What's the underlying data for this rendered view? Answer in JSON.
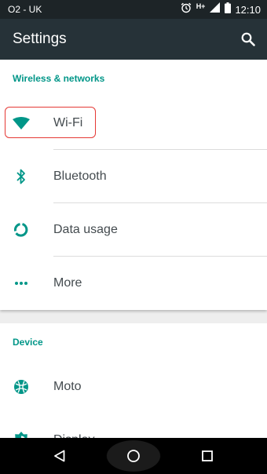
{
  "status_bar": {
    "carrier": "O2 - UK",
    "network_type": "H+",
    "time": "12:10",
    "icons": [
      "alarm-icon",
      "signal-icon",
      "battery-icon"
    ]
  },
  "app_bar": {
    "title": "Settings",
    "action_icon": "search-icon"
  },
  "sections": [
    {
      "header": "Wireless & networks",
      "items": [
        {
          "label": "Wi-Fi",
          "icon": "wifi-icon",
          "highlighted": true
        },
        {
          "label": "Bluetooth",
          "icon": "bluetooth-icon"
        },
        {
          "label": "Data usage",
          "icon": "data-usage-icon"
        },
        {
          "label": "More",
          "icon": "more-icon"
        }
      ]
    },
    {
      "header": "Device",
      "items": [
        {
          "label": "Moto",
          "icon": "moto-icon"
        },
        {
          "label": "Display",
          "icon": "display-icon"
        }
      ]
    }
  ],
  "nav_bar": {
    "buttons": [
      "back-icon",
      "home-icon",
      "recents-icon"
    ]
  },
  "colors": {
    "accent": "#009688",
    "app_bar": "#263238",
    "status_bar": "#1d2427",
    "highlight": "#e53935",
    "label": "#444b4f"
  }
}
